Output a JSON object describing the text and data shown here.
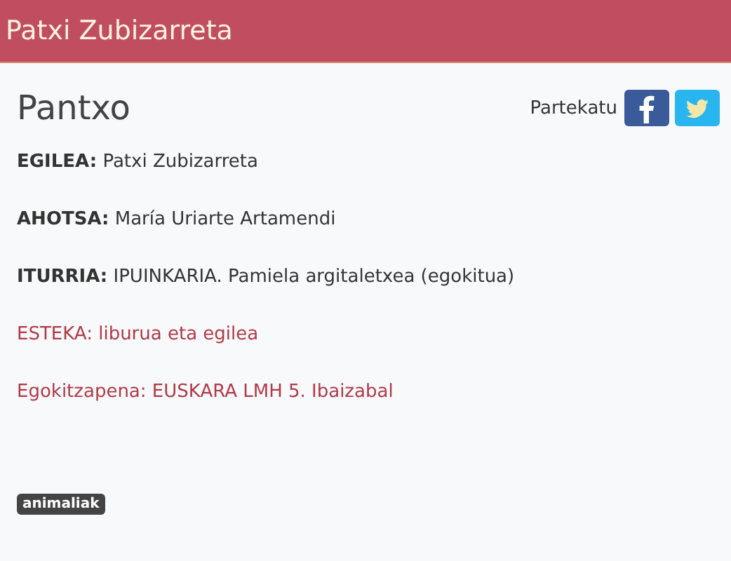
{
  "header": {
    "title": "Patxi Zubizarreta"
  },
  "title": "Pantxo",
  "share": {
    "label": "Partekatu"
  },
  "credits": [
    {
      "kind": "field",
      "text": "**EGILEA:** Patxi Zubizarreta"
    },
    {
      "kind": "field",
      "text": "**AHOTSA:** María Uriarte Artamendi"
    },
    {
      "kind": "field",
      "text": "**ITURRIA:** IPUINKARIA. Pamiela argitaletxea (egokitua)"
    },
    {
      "kind": "link",
      "text": "ESTEKA: liburua eta egilea"
    },
    {
      "kind": "link",
      "text": "Egokitzapena: EUSKARA LMH 5. Ibaizabal"
    }
  ],
  "tags": [
    "animaliak"
  ]
}
